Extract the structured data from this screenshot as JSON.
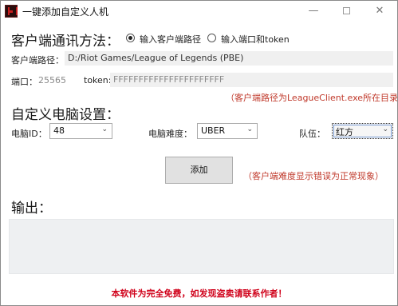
{
  "window": {
    "title": "一键添加自定义人机",
    "minimize": "—",
    "maximize": "",
    "close": "✕"
  },
  "connection": {
    "heading": "客户端通讯方法：",
    "radio_path_label": "输入客户端路径",
    "radio_token_label": "输入端口和token",
    "selected": "path",
    "path_label": "客户端路径：",
    "path_value": "D:/Riot Games/League of Legends (PBE)",
    "port_label": "端口：",
    "port_value": "25565",
    "token_label": "token:",
    "token_value": "FFFFFFFFFFFFFFFFFFFFFF",
    "hint": "（客户端路径为LeagueClient.exe所在目录）"
  },
  "bot": {
    "heading": "自定义电脑设置：",
    "id_label": "电脑ID：",
    "id_value": "48",
    "difficulty_label": "电脑难度：",
    "difficulty_value": "UBER",
    "team_label": "队伍：",
    "team_value": "红方",
    "add_button": "添加",
    "hint": "（客户端难度显示错误为正常现象）"
  },
  "output": {
    "heading": "输出：",
    "text": ""
  },
  "footer": {
    "notice": "本软件为完全免费，如发现盗卖请联系作者！"
  },
  "icons": {
    "app": "app-logo-icon",
    "chevron": "chevron-down-icon"
  }
}
